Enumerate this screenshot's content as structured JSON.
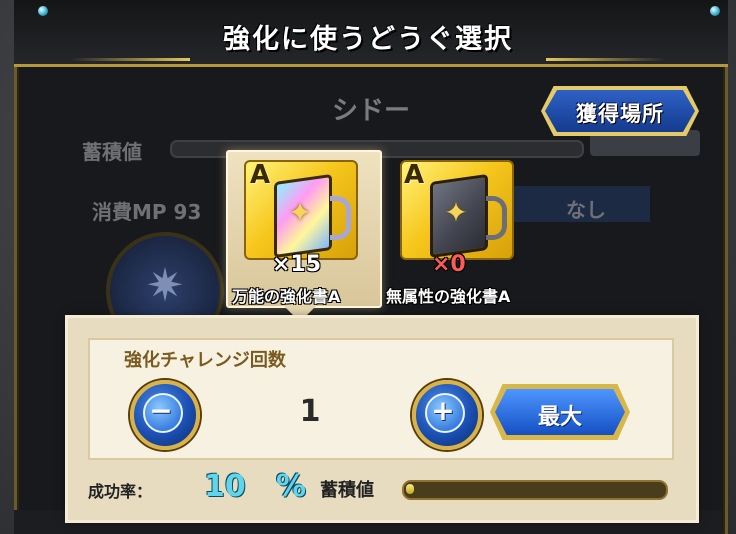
{
  "header": {
    "title": "強化に使うどうぐ選択"
  },
  "background": {
    "character_name": "シドー",
    "accumulation_label": "蓄積値",
    "mp_label": "消費MP 93",
    "element_value": "なし"
  },
  "acquire_button": {
    "label": "獲得場所"
  },
  "items": [
    {
      "grade": "A",
      "quantity": "×15",
      "name": "万能の強化書A",
      "selected": true,
      "quantity_color": "#ffffff"
    },
    {
      "grade": "A",
      "quantity": "×0",
      "name": "無属性の強化書A",
      "selected": false,
      "quantity_color": "#ff5a5a"
    }
  ],
  "challenge": {
    "count_label": "強化チャレンジ回数",
    "count_value": "1",
    "minus_glyph": "−",
    "plus_glyph": "+",
    "max_label": "最大",
    "success_label": "成功率：",
    "success_value": "10",
    "success_unit": "%",
    "accumulation_label": "蓄積値",
    "accumulation_fraction": 0.03
  },
  "icons": {
    "book": "spellbook-icon",
    "star": "star-emblem-icon",
    "minus": "minus-icon",
    "plus": "plus-icon"
  }
}
